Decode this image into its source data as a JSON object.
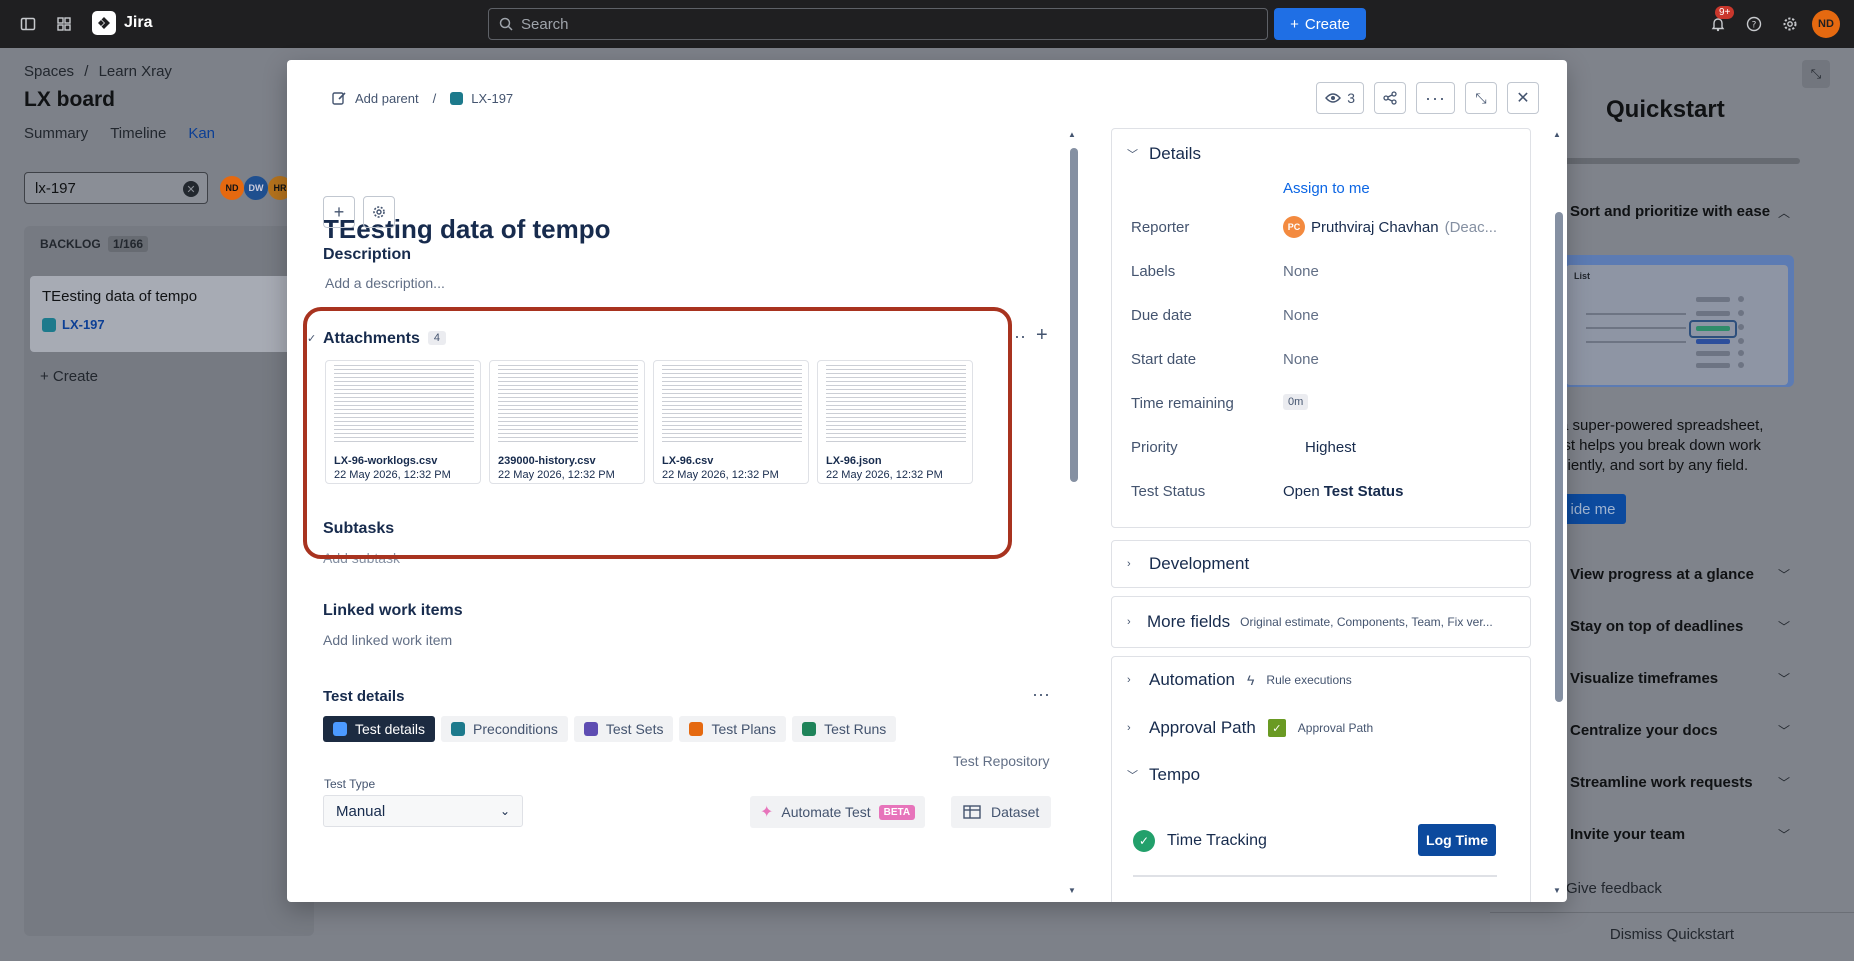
{
  "topnav": {
    "app_name": "Jira",
    "search_placeholder": "Search",
    "create_label": "Create",
    "notif_count": "9+",
    "user_initials": "ND"
  },
  "board": {
    "breadcrumb_space": "Spaces",
    "breadcrumb_sep": "/",
    "breadcrumb_project": "Learn Xray",
    "title": "LX board",
    "tabs": [
      "Summary",
      "Timeline",
      "Kan"
    ],
    "search_value": "lx-197",
    "avatars": [
      "ND",
      "DW",
      "HR"
    ],
    "column_name": "BACKLOG",
    "column_count": "1/166",
    "card_title": "TEesting data of tempo",
    "card_key": "LX-197",
    "create_label": "+ Create"
  },
  "quickstart": {
    "title": "Quickstart",
    "items": [
      "Sort and prioritize with ease",
      "View progress at a glance",
      "Stay on top of deadlines",
      "Visualize timeframes",
      "Centralize your docs",
      "Streamline work requests",
      "Invite your team"
    ],
    "illus_label": "List",
    "description": "a super-powered spreadsheet, ist helps you break down work ciently, and sort by any field.",
    "guide_button": "ide me",
    "feedback": "Give feedback",
    "dismiss": "Dismiss Quickstart"
  },
  "modal": {
    "add_parent": "Add parent",
    "crumb_sep": "/",
    "issue_key": "LX-197",
    "watchers": "3",
    "title": "TEesting data of tempo",
    "description_heading": "Description",
    "description_placeholder": "Add a description...",
    "attachments_heading": "Attachments",
    "attachments_count": "4",
    "attachments": [
      {
        "name": "LX-96-worklogs.csv",
        "date": "22 May 2026, 12:32 PM"
      },
      {
        "name": "239000-history.csv",
        "date": "22 May 2026, 12:32 PM"
      },
      {
        "name": "LX-96.csv",
        "date": "22 May 2026, 12:32 PM"
      },
      {
        "name": "LX-96.json",
        "date": "22 May 2026, 12:32 PM"
      }
    ],
    "subtasks_heading": "Subtasks",
    "subtasks_placeholder": "Add subtask",
    "linked_heading": "Linked work items",
    "linked_placeholder": "Add linked work item",
    "test_details_heading": "Test details",
    "test_tabs": [
      "Test details",
      "Preconditions",
      "Test Sets",
      "Test Plans",
      "Test Runs"
    ],
    "test_repository": "Test Repository",
    "test_type_label": "Test Type",
    "test_type_value": "Manual",
    "automate_label": "Automate Test",
    "beta_label": "BETA",
    "dataset_label": "Dataset"
  },
  "details": {
    "heading": "Details",
    "assign_to_me": "Assign to me",
    "fields": [
      {
        "label": "Reporter",
        "value": "Pruthviraj Chavhan",
        "suffix": "(Deac...",
        "initials": "PC"
      },
      {
        "label": "Labels",
        "value": "None"
      },
      {
        "label": "Due date",
        "value": "None"
      },
      {
        "label": "Start date",
        "value": "None"
      },
      {
        "label": "Time remaining",
        "value": "0m"
      },
      {
        "label": "Priority",
        "value": "Highest"
      },
      {
        "label": "Test Status",
        "value": "Open",
        "value_bold": "Test Status"
      }
    ]
  },
  "sections": {
    "development": "Development",
    "more_fields": "More fields",
    "more_fields_extra": "Original estimate, Components, Team, Fix ver...",
    "automation": "Automation",
    "automation_extra": "Rule executions",
    "approval": "Approval Path",
    "approval_extra": "Approval Path",
    "tempo": "Tempo",
    "time_tracking": "Time Tracking",
    "log_time": "Log Time"
  }
}
